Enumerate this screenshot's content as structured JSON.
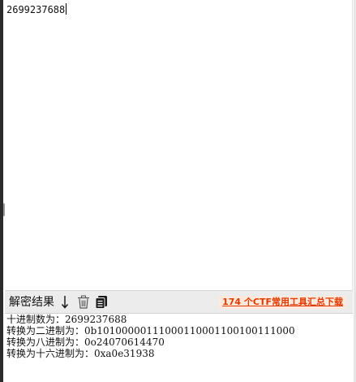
{
  "input": {
    "value": "2699237688"
  },
  "toolbar": {
    "label": "解密结果",
    "icons": [
      "down-arrow-icon",
      "trash-icon",
      "copy-icon"
    ],
    "promo_link": "174 个CTF常用工具汇总下载",
    "promo_color": "#e03a00"
  },
  "output": {
    "lines": [
      "十进制数为：2699237688",
      "转换为二进制为：0b10100000111000110001100100111000",
      "转换为八进制为：0o24070614470",
      "转换为十六进制为：0xa0e31938"
    ]
  }
}
